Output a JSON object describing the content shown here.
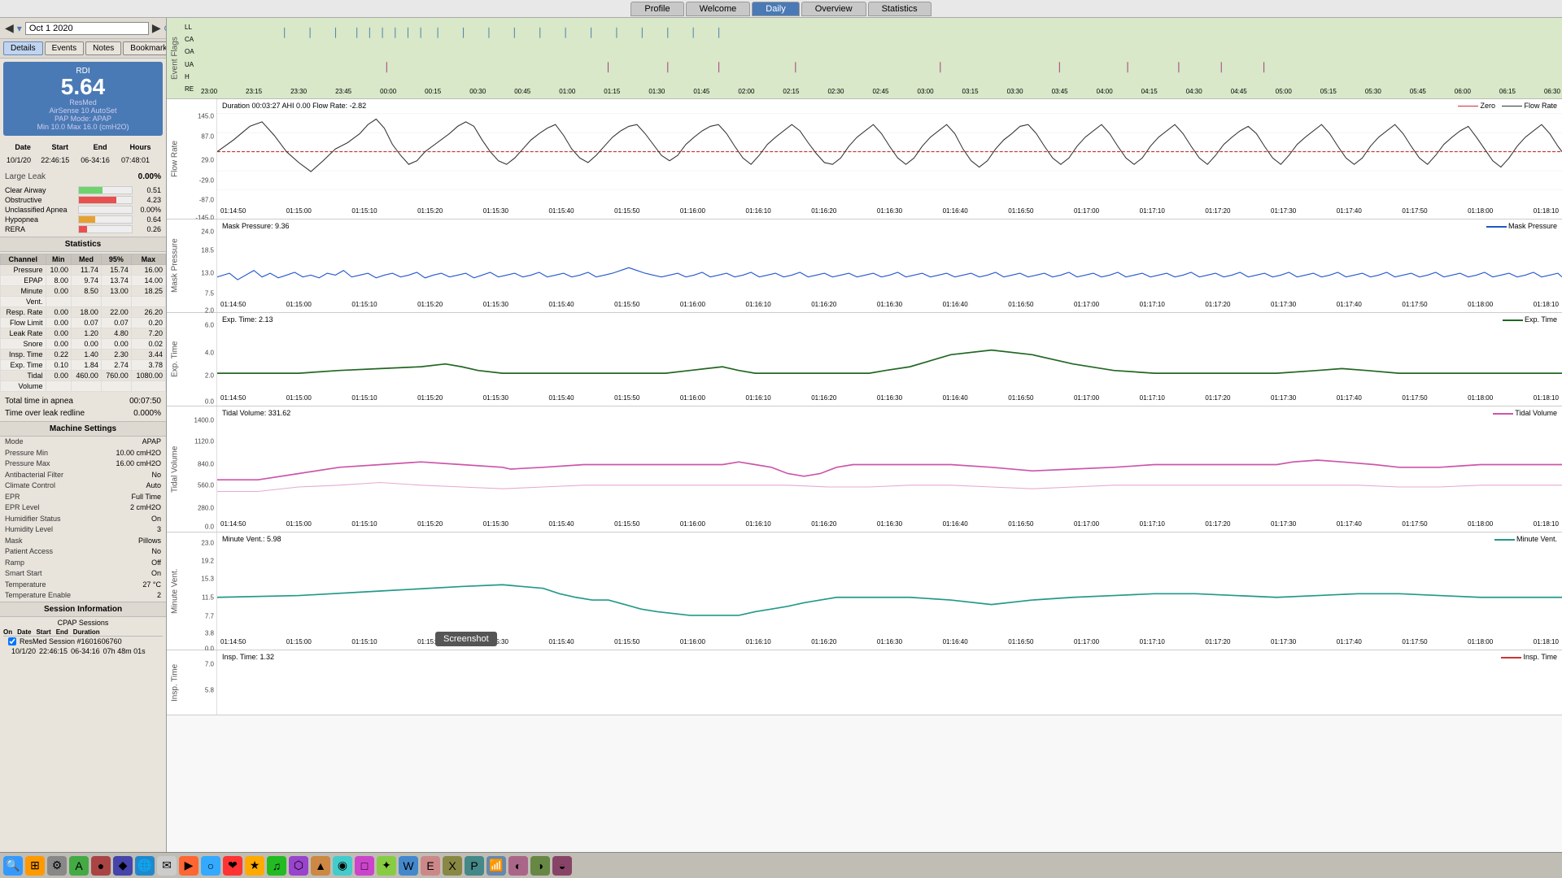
{
  "nav": {
    "tabs": [
      {
        "label": "Profile",
        "active": false
      },
      {
        "label": "Welcome",
        "active": false
      },
      {
        "label": "Daily",
        "active": true
      },
      {
        "label": "Overview",
        "active": false
      },
      {
        "label": "Statistics",
        "active": false
      }
    ]
  },
  "sidebar": {
    "date": "Oct 1 2020",
    "buttons": [
      {
        "label": "Details",
        "active": true
      },
      {
        "label": "Events",
        "active": false
      },
      {
        "label": "Notes",
        "active": false
      },
      {
        "label": "Bookmarks",
        "active": false
      }
    ],
    "rdi": {
      "label": "RDI",
      "value": "5.64"
    },
    "device_info": {
      "brand": "ResMed",
      "model": "AirSense 10 AutoSet",
      "pap_mode": "PAP Mode: APAP",
      "min_max": "Min 10.0 Max 16.0 (cmH2O)"
    },
    "session": {
      "date": "10/1/20",
      "start": "22:46:15",
      "end": "06-34:16",
      "hours": "07:48:01"
    },
    "large_leak": {
      "label": "Large Leak",
      "value": "0.00%"
    },
    "events": [
      {
        "label": "Clear Airway",
        "color": "#6dd46d",
        "value": "0.51"
      },
      {
        "label": "Obstructive",
        "color": "#e85050",
        "value": "4.23"
      },
      {
        "label": "Unclassified Apnea",
        "color": "#5050e8",
        "value": "0.00%"
      },
      {
        "label": "Hypopnea",
        "color": "#e8a030",
        "value": "0.64"
      },
      {
        "label": "RERA",
        "color": "#e85050",
        "value": "0.26"
      }
    ],
    "statistics": {
      "title": "Statistics",
      "headers": [
        "Channel",
        "Min",
        "Med",
        "95%",
        "Max"
      ],
      "rows": [
        [
          "Pressure",
          "10.00",
          "11.74",
          "15.74",
          "16.00"
        ],
        [
          "EPAP",
          "8.00",
          "9.74",
          "13.74",
          "14.00"
        ],
        [
          "Minute",
          "0.00",
          "8.50",
          "13.00",
          "18.25"
        ],
        [
          "Vent.",
          "",
          "",
          "",
          ""
        ],
        [
          "Resp. Rate",
          "0.00",
          "18.00",
          "22.00",
          "26.20"
        ],
        [
          "Flow Limit",
          "0.00",
          "0.07",
          "0.07",
          "0.20"
        ],
        [
          "Leak Rate",
          "0.00",
          "1.20",
          "4.80",
          "7.20"
        ],
        [
          "Snore",
          "0.00",
          "0.00",
          "0.00",
          "0.02"
        ],
        [
          "Insp. Time",
          "0.22",
          "1.40",
          "2.30",
          "3.44"
        ],
        [
          "Exp. Time",
          "0.10",
          "1.84",
          "2.74",
          "3.78"
        ],
        [
          "Tidal",
          "0.00",
          "460.00",
          "760.00",
          "1080.00"
        ],
        [
          "Volume",
          "",
          "",
          "",
          ""
        ]
      ]
    },
    "apnea_info": {
      "total_time": "00:07:50",
      "time_over_leak": "0.000%"
    },
    "machine_settings": {
      "title": "Machine Settings",
      "rows": [
        [
          "Mode",
          "APAP"
        ],
        [
          "Pressure Min",
          "10.00 cmH2O"
        ],
        [
          "Pressure Max",
          "16.00 cmH2O"
        ],
        [
          "Antibacterial Filter",
          "No"
        ],
        [
          "Climate Control",
          "Auto"
        ],
        [
          "EPR",
          "Full Time"
        ],
        [
          "EPR Level",
          "2 cmH2O"
        ],
        [
          "Humidifier Status",
          "On"
        ],
        [
          "Humidity Level",
          "3"
        ],
        [
          "Mask",
          "Pillows"
        ],
        [
          "Patient Access",
          "No"
        ],
        [
          "Ramp",
          "Off"
        ],
        [
          "Smart Start",
          "On"
        ],
        [
          "Temperature",
          "27 °C"
        ],
        [
          "Temperature Enable",
          "2"
        ]
      ]
    },
    "session_info": {
      "title": "Session Information",
      "subtitle": "CPAP Sessions",
      "headers": [
        "On",
        "Date",
        "Start",
        "End",
        "Duration"
      ],
      "row": {
        "checked": true,
        "name": "ResMed Session #1601606760",
        "date": "10/1/20",
        "start": "22:46:15",
        "end": "06-34:16",
        "duration": "07h 48m 01s"
      }
    }
  },
  "charts": {
    "event_flags": {
      "title": "Event Flags",
      "labels": [
        "LL",
        "CA",
        "OA",
        "UA",
        "H",
        "RE"
      ]
    },
    "flow_rate": {
      "title": "Flow Rate",
      "header_left": "Duration 00:03:27 AHI 0.00 Flow Rate: -2.82",
      "legend_zero": "Zero",
      "legend_flow": "Flow Rate",
      "y_labels": [
        "145.0",
        "87.0",
        "29.0",
        "-29.0",
        "-87.0",
        "-145.0"
      ],
      "time_labels": [
        "01:14:50",
        "01:15:00",
        "01:15:10",
        "01:15:20",
        "01:15:30",
        "01:15:40",
        "01:15:50",
        "01:16:00",
        "01:16:10",
        "01:16:20",
        "01:16:30",
        "01:16:40",
        "01:16:50",
        "01:17:00",
        "01:17:10",
        "01:17:20",
        "01:17:30",
        "01:17:40",
        "01:17:50",
        "01:18:00",
        "01:18:10"
      ]
    },
    "mask_pressure": {
      "title": "Mask Pressure",
      "header_left": "Mask Pressure: 9.36",
      "y_labels": [
        "24.0",
        "18.5",
        "13.0",
        "7.5",
        "2.0"
      ]
    },
    "exp_time": {
      "title": "Exp. Time",
      "header_left": "Exp. Time: 2.13",
      "y_labels": [
        "6.0",
        "4.0",
        "2.0",
        "0.0"
      ]
    },
    "tidal_volume": {
      "title": "Tidal Volume",
      "header_left": "Tidal Volume: 331.62",
      "y_labels": [
        "1400.0",
        "1120.0",
        "840.0",
        "560.0",
        "280.0",
        "0.0"
      ]
    },
    "minute_vent": {
      "title": "Minute Vent.",
      "header_left": "Minute Vent.: 5.98",
      "y_labels": [
        "23.0",
        "19.2",
        "15.3",
        "11.5",
        "7.7",
        "3.8",
        "0.0"
      ]
    },
    "insp_time": {
      "title": "Insp. Time",
      "header_left": "Insp. Time: 1.32",
      "y_labels": [
        "7.0",
        "5.8"
      ]
    }
  },
  "tooltip": {
    "label": "Screenshot"
  },
  "colors": {
    "accent": "#4a7ab5",
    "flow_rate_line": "#333333",
    "zero_line": "#cc3333",
    "mask_pressure_line": "#2255cc",
    "exp_time_line": "#226622",
    "tidal_volume_line": "#cc55aa",
    "minute_vent_line": "#229988",
    "insp_time_line": "#cc3333",
    "selected_region": "rgba(100,140,200,0.25)"
  }
}
